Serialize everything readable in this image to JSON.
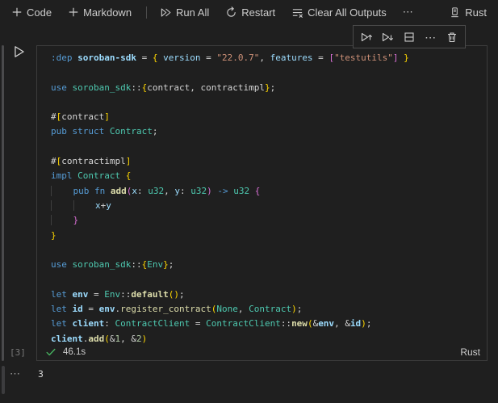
{
  "ui_colors": {
    "bg": "#1f1f1f",
    "fg": "#cccccc",
    "border": "#3c3c3c",
    "success": "#46b15f",
    "muted": "#787878",
    "guide": "#3f3f3f"
  },
  "syntax_colors": {
    "kw": "#569cd6",
    "var": "#9cdcfe",
    "type": "#4ec9b0",
    "fn": "#dcdcaa",
    "str": "#ce9178",
    "num": "#b5cea8",
    "pun": "#d4d4d4",
    "b1": "#ffd700",
    "b2": "#da70d6"
  },
  "notebook_toolbar": {
    "code_label": "Code",
    "markdown_label": "Markdown",
    "run_all_label": "Run All",
    "restart_label": "Restart",
    "clear_outputs_label": "Clear All Outputs",
    "more_label": "⋯",
    "kernel_name": "Rust"
  },
  "cell_toolbar": {
    "buttons": [
      "run-cell-and-above",
      "run-cell-and-below",
      "split-cell",
      "more-actions",
      "delete-cell"
    ],
    "more_label": "⋯"
  },
  "cell": {
    "execution_count": "[3]",
    "status_bar": {
      "duration": "46.1s",
      "language": "Rust"
    },
    "code": {
      "lines": [
        [
          [
            ":dep",
            "kw"
          ],
          [
            " ",
            "pun"
          ],
          [
            "soroban-sdk",
            "var",
            true
          ],
          [
            " = ",
            "pun"
          ],
          [
            "{",
            "b1"
          ],
          [
            " ",
            "pun"
          ],
          [
            "version",
            "var"
          ],
          [
            " = ",
            "pun"
          ],
          [
            "\"22.0.7\"",
            "str"
          ],
          [
            ", ",
            "pun"
          ],
          [
            "features",
            "var"
          ],
          [
            " = ",
            "pun"
          ],
          [
            "[",
            "b2"
          ],
          [
            "\"testutils\"",
            "str"
          ],
          [
            "]",
            "b2"
          ],
          [
            " ",
            "pun"
          ],
          [
            "}",
            "b1"
          ]
        ],
        [],
        [
          [
            "use",
            "kw"
          ],
          [
            " ",
            "pun"
          ],
          [
            "soroban_sdk",
            "type"
          ],
          [
            "::",
            "pun"
          ],
          [
            "{",
            "b1"
          ],
          [
            "contract",
            "pun"
          ],
          [
            ", ",
            "pun"
          ],
          [
            "contractimpl",
            "pun"
          ],
          [
            "}",
            "b1"
          ],
          [
            ";",
            "pun"
          ]
        ],
        [],
        [
          [
            "#",
            "pun"
          ],
          [
            "[",
            "b1"
          ],
          [
            "contract",
            "pun"
          ],
          [
            "]",
            "b1"
          ]
        ],
        [
          [
            "pub",
            "kw"
          ],
          [
            " ",
            "pun"
          ],
          [
            "struct",
            "kw"
          ],
          [
            " ",
            "pun"
          ],
          [
            "Contract",
            "type"
          ],
          [
            ";",
            "pun"
          ]
        ],
        [],
        [
          [
            "#",
            "pun"
          ],
          [
            "[",
            "b1"
          ],
          [
            "contractimpl",
            "pun"
          ],
          [
            "]",
            "b1"
          ]
        ],
        [
          [
            "impl",
            "kw"
          ],
          [
            " ",
            "pun"
          ],
          [
            "Contract",
            "type"
          ],
          [
            " ",
            "pun"
          ],
          [
            "{",
            "b1"
          ]
        ],
        [
          [
            "    ",
            "guide"
          ],
          [
            "pub",
            "kw"
          ],
          [
            " ",
            "pun"
          ],
          [
            "fn",
            "kw"
          ],
          [
            " ",
            "pun"
          ],
          [
            "add",
            "fn",
            true
          ],
          [
            "(",
            "b2"
          ],
          [
            "x",
            "var"
          ],
          [
            ": ",
            "pun"
          ],
          [
            "u32",
            "type"
          ],
          [
            ", ",
            "pun"
          ],
          [
            "y",
            "var"
          ],
          [
            ": ",
            "pun"
          ],
          [
            "u32",
            "type"
          ],
          [
            ")",
            "b2"
          ],
          [
            " ",
            "pun"
          ],
          [
            "->",
            "kw"
          ],
          [
            " ",
            "pun"
          ],
          [
            "u32",
            "type"
          ],
          [
            " ",
            "pun"
          ],
          [
            "{",
            "b2"
          ]
        ],
        [
          [
            "    ",
            "guide"
          ],
          [
            "    ",
            "guide"
          ],
          [
            "x",
            "var"
          ],
          [
            "+",
            "pun"
          ],
          [
            "y",
            "var"
          ]
        ],
        [
          [
            "    ",
            "guide"
          ],
          [
            "}",
            "b2"
          ]
        ],
        [
          [
            "}",
            "b1"
          ]
        ],
        [],
        [
          [
            "use",
            "kw"
          ],
          [
            " ",
            "pun"
          ],
          [
            "soroban_sdk",
            "type"
          ],
          [
            "::",
            "pun"
          ],
          [
            "{",
            "b1"
          ],
          [
            "Env",
            "type"
          ],
          [
            "}",
            "b1"
          ],
          [
            ";",
            "pun"
          ]
        ],
        [],
        [
          [
            "let",
            "kw"
          ],
          [
            " ",
            "pun"
          ],
          [
            "env",
            "var",
            true
          ],
          [
            " = ",
            "pun"
          ],
          [
            "Env",
            "type"
          ],
          [
            "::",
            "pun"
          ],
          [
            "default",
            "fn",
            true
          ],
          [
            "(",
            "b1"
          ],
          [
            ")",
            "b1"
          ],
          [
            ";",
            "pun"
          ]
        ],
        [
          [
            "let",
            "kw"
          ],
          [
            " ",
            "pun"
          ],
          [
            "id",
            "var",
            true
          ],
          [
            " = ",
            "pun"
          ],
          [
            "env",
            "var",
            true
          ],
          [
            ".",
            "pun"
          ],
          [
            "register_contract",
            "fn"
          ],
          [
            "(",
            "b1"
          ],
          [
            "None",
            "type"
          ],
          [
            ", ",
            "pun"
          ],
          [
            "Contract",
            "type"
          ],
          [
            ")",
            "b1"
          ],
          [
            ";",
            "pun"
          ]
        ],
        [
          [
            "let",
            "kw"
          ],
          [
            " ",
            "pun"
          ],
          [
            "client",
            "var",
            true
          ],
          [
            ": ",
            "pun"
          ],
          [
            "ContractClient",
            "type"
          ],
          [
            " = ",
            "pun"
          ],
          [
            "ContractClient",
            "type"
          ],
          [
            "::",
            "pun"
          ],
          [
            "new",
            "fn",
            true
          ],
          [
            "(",
            "b1"
          ],
          [
            "&",
            "pun"
          ],
          [
            "env",
            "var",
            true
          ],
          [
            ", ",
            "pun"
          ],
          [
            "&",
            "pun"
          ],
          [
            "id",
            "var",
            true
          ],
          [
            ")",
            "b1"
          ],
          [
            ";",
            "pun"
          ]
        ],
        [
          [
            "client",
            "var",
            true
          ],
          [
            ".",
            "pun"
          ],
          [
            "add",
            "fn",
            true
          ],
          [
            "(",
            "b1"
          ],
          [
            "&",
            "pun"
          ],
          [
            "1",
            "num"
          ],
          [
            ", ",
            "pun"
          ],
          [
            "&",
            "pun"
          ],
          [
            "2",
            "num"
          ],
          [
            ")",
            "b1"
          ]
        ]
      ]
    }
  },
  "output": {
    "expand_indicator": "⋯",
    "value": "3"
  }
}
